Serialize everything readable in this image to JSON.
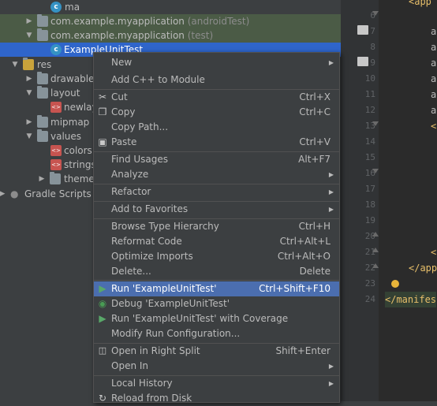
{
  "tree": {
    "items": [
      {
        "label": "ma",
        "note": ""
      },
      {
        "label": "com.example.myapplication",
        "note": "(androidTest)"
      },
      {
        "label": "com.example.myapplication",
        "note": "(test)"
      },
      {
        "label": "ExampleUnitTest",
        "note": ""
      },
      {
        "label": "res",
        "note": ""
      },
      {
        "label": "drawable",
        "note": ""
      },
      {
        "label": "layout",
        "note": ""
      },
      {
        "label": "newlay",
        "note": ""
      },
      {
        "label": "mipmap",
        "note": ""
      },
      {
        "label": "values",
        "note": ""
      },
      {
        "label": "colors.",
        "note": ""
      },
      {
        "label": "strings.",
        "note": ""
      },
      {
        "label": "themes",
        "note": ""
      },
      {
        "label": "Gradle Scripts",
        "note": ""
      }
    ]
  },
  "editor": {
    "lines": [
      "6",
      "7",
      "8",
      "9",
      "10",
      "11",
      "12",
      "13",
      "14",
      "15",
      "16",
      "17",
      "18",
      "19",
      "20",
      "21",
      "22",
      "23",
      "24"
    ],
    "code": [
      "<app",
      "a",
      "a",
      "a",
      "a",
      "a",
      "a",
      "<",
      "<",
      "</app",
      "</manifes"
    ]
  },
  "menu": {
    "items": [
      {
        "label": "New",
        "shortcut": ""
      },
      {
        "label": "Add C++ to Module",
        "shortcut": ""
      },
      {
        "label": "Cut",
        "shortcut": "Ctrl+X"
      },
      {
        "label": "Copy",
        "shortcut": "Ctrl+C"
      },
      {
        "label": "Copy Path...",
        "shortcut": ""
      },
      {
        "label": "Paste",
        "shortcut": "Ctrl+V"
      },
      {
        "label": "Find Usages",
        "shortcut": "Alt+F7"
      },
      {
        "label": "Analyze",
        "shortcut": ""
      },
      {
        "label": "Refactor",
        "shortcut": ""
      },
      {
        "label": "Add to Favorites",
        "shortcut": ""
      },
      {
        "label": "Browse Type Hierarchy",
        "shortcut": "Ctrl+H"
      },
      {
        "label": "Reformat Code",
        "shortcut": "Ctrl+Alt+L"
      },
      {
        "label": "Optimize Imports",
        "shortcut": "Ctrl+Alt+O"
      },
      {
        "label": "Delete...",
        "shortcut": "Delete"
      },
      {
        "label": "Run 'ExampleUnitTest'",
        "shortcut": "Ctrl+Shift+F10"
      },
      {
        "label": "Debug 'ExampleUnitTest'",
        "shortcut": ""
      },
      {
        "label": "Run 'ExampleUnitTest' with Coverage",
        "shortcut": ""
      },
      {
        "label": "Modify Run Configuration...",
        "shortcut": ""
      },
      {
        "label": "Open in Right Split",
        "shortcut": "Shift+Enter"
      },
      {
        "label": "Open In",
        "shortcut": ""
      },
      {
        "label": "Local History",
        "shortcut": ""
      },
      {
        "label": "Reload from Disk",
        "shortcut": ""
      }
    ]
  },
  "colors": {
    "background": "#3c3f41",
    "selection": "#2f65ca",
    "menu_active": "#4b6eaf",
    "test_highlight": "#4b5b46",
    "editor_bg": "#2b2b2b",
    "run_icon": "#59a869",
    "debug_icon": "#499c54"
  }
}
